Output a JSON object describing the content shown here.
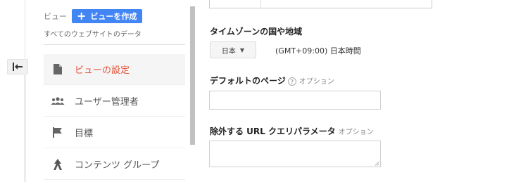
{
  "back_button": {
    "icon": "back-arrow-icon"
  },
  "view_selector": {
    "label": "ビュー",
    "create_label": "ビューを作成",
    "current": "すべてのウェブサイトのデータ"
  },
  "menu": {
    "items": [
      {
        "label": "ビューの設定",
        "icon": "document-icon",
        "active": true
      },
      {
        "label": "ユーザー管理者",
        "icon": "users-icon",
        "active": false
      },
      {
        "label": "目標",
        "icon": "flag-icon",
        "active": false
      },
      {
        "label": "コンテンツ グループ",
        "icon": "content-group-icon",
        "active": false
      }
    ]
  },
  "settings": {
    "timezone": {
      "label": "タイムゾーンの国や地域",
      "country": "日本",
      "value": "(GMT+09:00) 日本時間"
    },
    "default_page": {
      "label": "デフォルトのページ",
      "optional": "オプション",
      "value": ""
    },
    "exclude_params": {
      "label": "除外する URL クエリパラメータ",
      "optional": "オプション",
      "value": ""
    }
  },
  "colors": {
    "accent": "#4285f4",
    "active_item": "#e6543a"
  }
}
